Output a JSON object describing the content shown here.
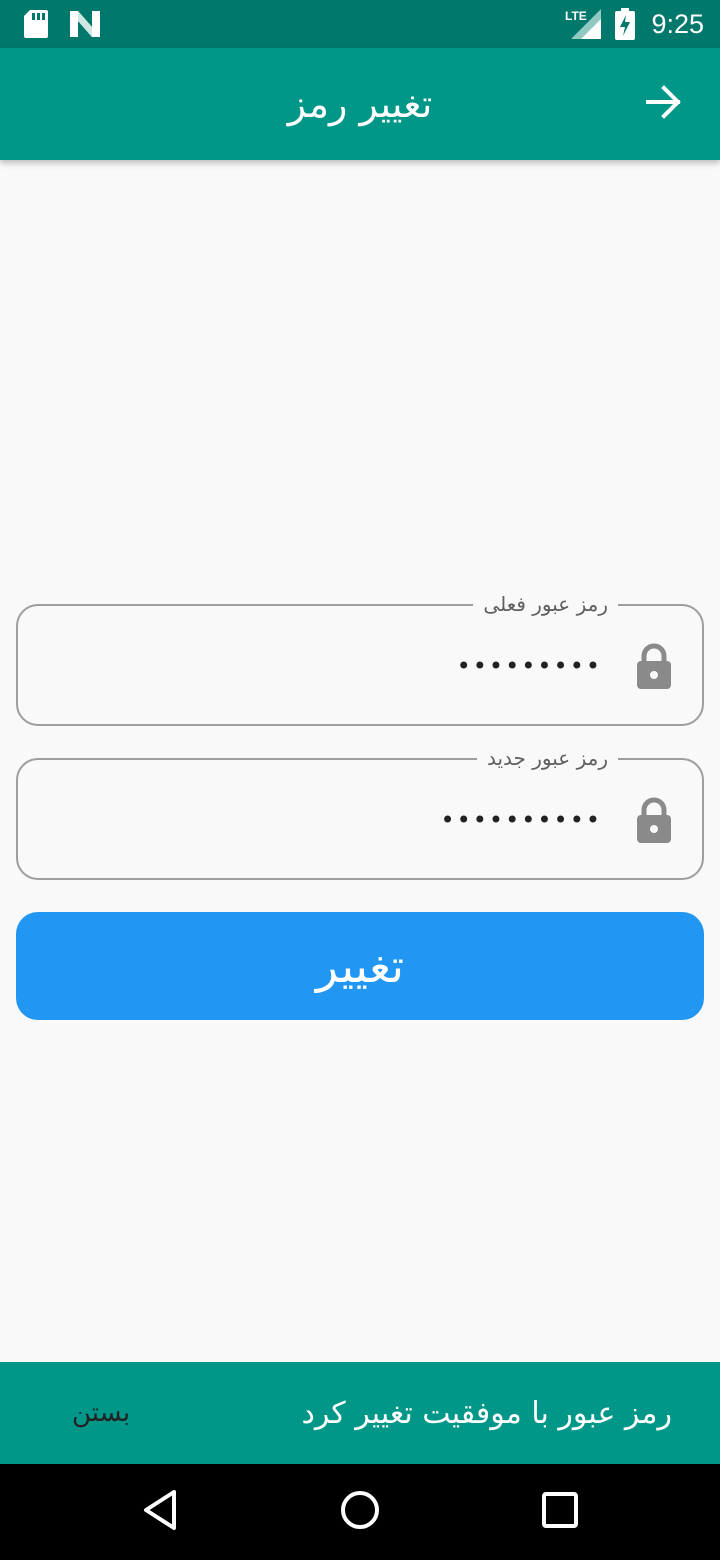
{
  "status_bar": {
    "network": "LTE",
    "time": "9:25"
  },
  "app_bar": {
    "title": "تغییر رمز",
    "back_icon": "arrow-forward-icon"
  },
  "form": {
    "current_password": {
      "label": "رمز عبور فعلی",
      "value": "•••••••••",
      "icon": "lock-icon"
    },
    "new_password": {
      "label": "رمز عبور جدید",
      "value": "••••••••••",
      "icon": "lock-icon"
    },
    "submit_label": "تغییر"
  },
  "snackbar": {
    "message": "رمز عبور با موفقیت تغییر کرد",
    "action_label": "بستن"
  },
  "colors": {
    "status_bar": "#00786b",
    "app_bar": "#009688",
    "primary_button": "#2196f3",
    "snackbar": "#009688",
    "background": "#f9f9f9"
  }
}
